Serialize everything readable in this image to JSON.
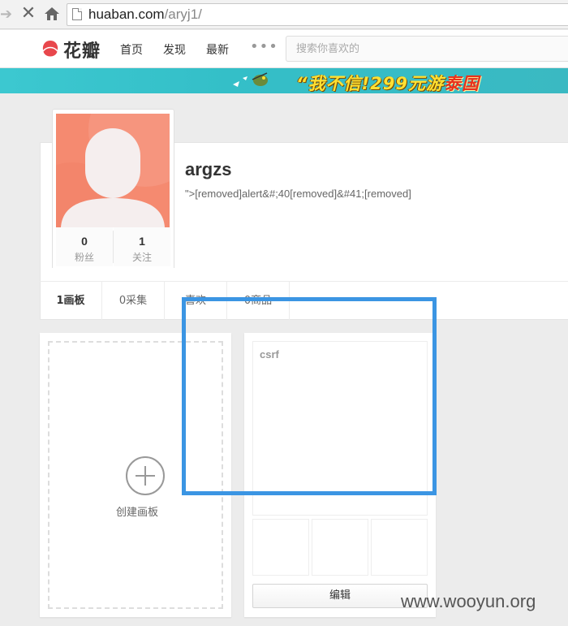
{
  "browser": {
    "url_host": "huaban.com",
    "url_path": "/aryj1/"
  },
  "header": {
    "logo_text": "花瓣",
    "nav": [
      "首页",
      "发现",
      "最新"
    ],
    "more": "•••",
    "search_placeholder": "搜索你喜欢的"
  },
  "banner": {
    "quote_open": "“",
    "text_main": "我不信!299元游",
    "text_em": "泰国"
  },
  "profile": {
    "username": "argzs",
    "bio": "\">[removed]alert&#;40[removed]&#41;[removed]",
    "stats": [
      {
        "count": "0",
        "label": "粉丝"
      },
      {
        "count": "1",
        "label": "关注"
      }
    ]
  },
  "tabs": [
    {
      "label": "1画板",
      "active": true
    },
    {
      "label": "0采集",
      "active": false
    },
    {
      "label": "喜欢",
      "active": false
    },
    {
      "label": "0商品",
      "active": false
    }
  ],
  "create_board": {
    "label": "创建画板"
  },
  "board": {
    "title": "csrf",
    "edit_label": "编辑"
  },
  "watermark": "www.wooyun.org",
  "colors": {
    "annotation": "#3b95e3",
    "brand": "#e8474c",
    "avatar_bg": "#f58a70",
    "banner_bg": "#3cc8d0"
  }
}
